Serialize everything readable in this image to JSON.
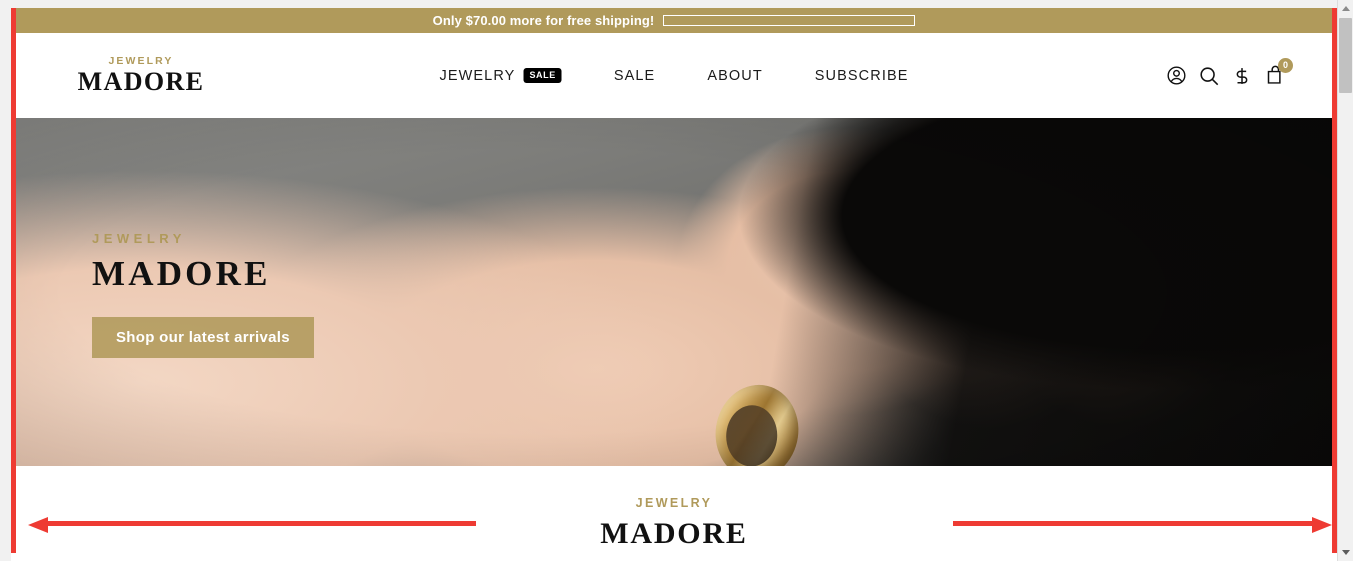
{
  "announcement": {
    "text": "Only $70.00 more for free shipping!",
    "progress_percent": 0,
    "background_color": "#b09a5b"
  },
  "header": {
    "logo": {
      "eyebrow": "JEWELRY",
      "name": "MADORE"
    },
    "nav": [
      {
        "label": "JEWELRY",
        "badge": "SALE"
      },
      {
        "label": "SALE",
        "badge": ""
      },
      {
        "label": "ABOUT",
        "badge": ""
      },
      {
        "label": "SUBSCRIBE",
        "badge": ""
      }
    ],
    "actions": {
      "account_icon": "account-icon",
      "search_icon": "search-icon",
      "currency_icon": "currency-dollar-icon",
      "cart_icon": "cart-icon",
      "cart_count": "0",
      "cart_badge_color": "#b09a5b"
    }
  },
  "hero": {
    "eyebrow": "JEWELRY",
    "title": "MADORE",
    "cta_label": "Shop our latest arrivals",
    "cta_color": "#b09a5b",
    "image_description": "hand-with-gold-ring-photo"
  },
  "lower_section": {
    "eyebrow": "JEWELRY",
    "brand": "MADORE"
  },
  "annotations": {
    "color": "#ee3b33",
    "left_arrow": "arrow-pointing-left",
    "right_arrow": "arrow-pointing-right",
    "border": "red-page-outline"
  },
  "scrollbar": {
    "up_arrow": "scroll-up-arrow",
    "down_arrow": "scroll-down-arrow",
    "thumb": "scrollbar-thumb"
  }
}
